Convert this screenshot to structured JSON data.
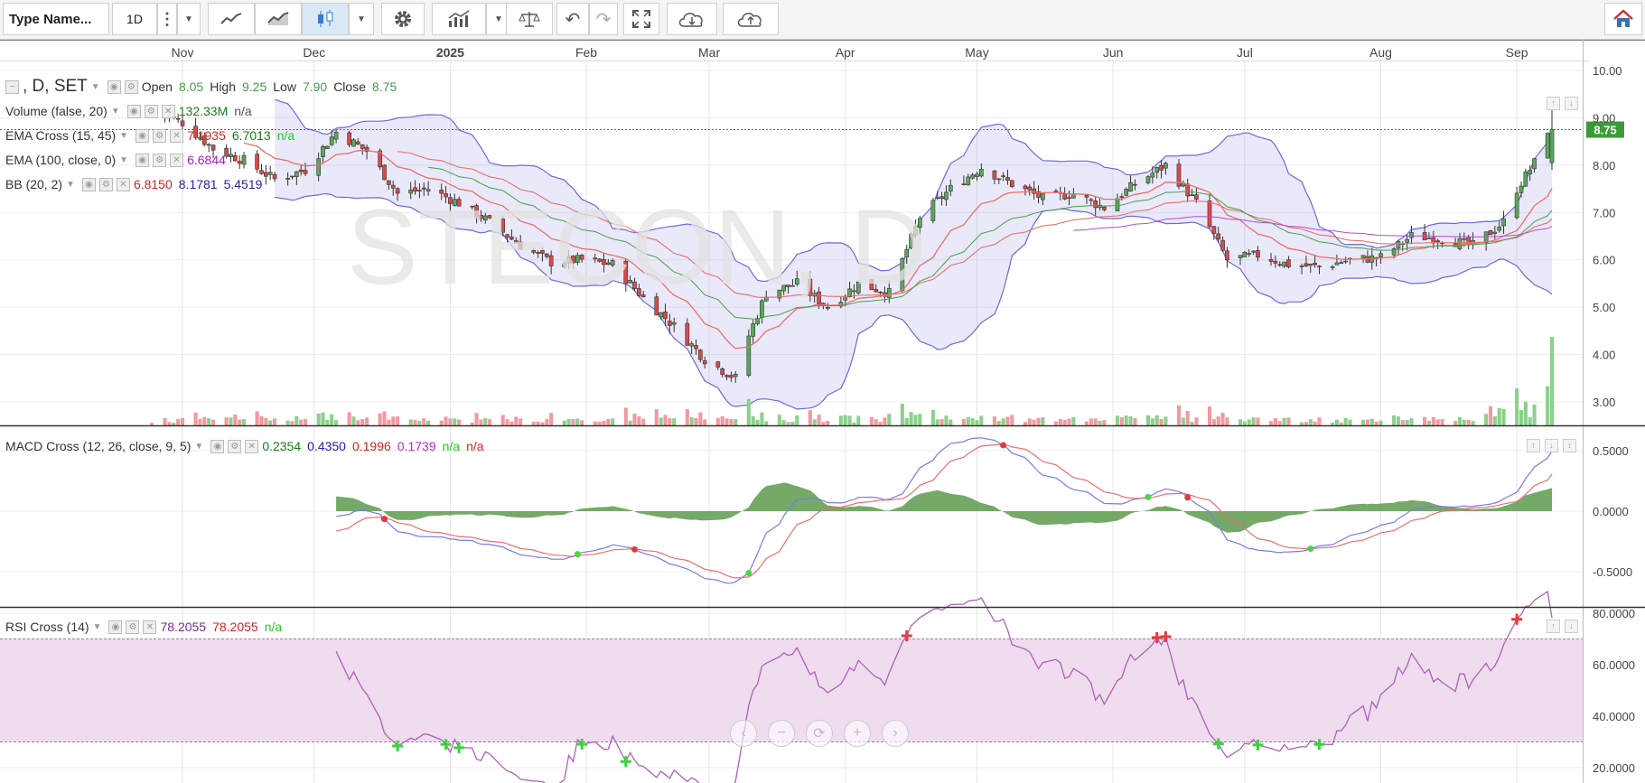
{
  "toolbar": {
    "symbol_placeholder": "Type Name...",
    "interval": "1D",
    "buttons": [
      "more-icon",
      "dropdown-icon",
      "line-chart-icon",
      "area-chart-icon",
      "candlestick-icon",
      "dropdown-icon",
      "settings-icon",
      "indicators-icon",
      "dropdown-icon",
      "compare-icon",
      "undo-icon",
      "redo-icon",
      "fullscreen-icon",
      "cloud-download-icon",
      "cloud-upload-icon",
      "home-icon"
    ]
  },
  "main": {
    "title": ", D, SET",
    "watermark": "STECON, D",
    "ohlc": {
      "open_label": "Open",
      "open": "8.05",
      "high_label": "High",
      "high": "9.25",
      "low_label": "Low",
      "low": "7.90",
      "close_label": "Close",
      "close": "8.75"
    },
    "last_price_tag": "8.75",
    "indicators": [
      {
        "name": "Volume (false, 20)",
        "values": [
          "132.33M",
          "n/a"
        ],
        "colors": [
          "#1a7a1a",
          "#555"
        ]
      },
      {
        "name": "EMA Cross (15, 45)",
        "values": [
          "7.1935",
          "6.7013",
          "n/a"
        ],
        "colors": [
          "#d22",
          "#1a7a1a",
          "#2c2"
        ]
      },
      {
        "name": "EMA (100, close, 0)",
        "values": [
          "6.6844"
        ],
        "colors": [
          "#a020c0"
        ]
      },
      {
        "name": "BB (20, 2)",
        "values": [
          "6.8150",
          "8.1781",
          "5.4519"
        ],
        "colors": [
          "#c22",
          "#22a",
          "#22a"
        ]
      }
    ]
  },
  "macd": {
    "name": "MACD Cross (12, 26, close, 9, 5)",
    "values": [
      "0.2354",
      "0.4350",
      "0.1996",
      "0.1739",
      "n/a",
      "n/a"
    ],
    "colors": [
      "#1a7a1a",
      "#22a",
      "#d22",
      "#c2c",
      "#2c2",
      "#d22"
    ]
  },
  "rsi": {
    "name": "RSI Cross (14)",
    "values": [
      "78.2055",
      "78.2055",
      "n/a"
    ],
    "colors": [
      "#7a2a9a",
      "#d22",
      "#2c2"
    ]
  },
  "chart_data": [
    {
      "type": "candlestick",
      "title": "STECON, D",
      "x_tick_labels": [
        "Nov",
        "Dec",
        "2025",
        "Feb",
        "Mar",
        "Apr",
        "May",
        "Jun",
        "Jul",
        "Aug",
        "Sep"
      ],
      "y_tick_labels": [
        "10.00",
        "9.00",
        "8.00",
        "7.00",
        "6.00",
        "5.00",
        "4.00",
        "3.00"
      ],
      "ylim": [
        2.55,
        10.1
      ],
      "series_close": [
        {
          "date": "2024-10-25",
          "close": 9.2
        },
        {
          "date": "2024-11-01",
          "close": 8.9
        },
        {
          "date": "2024-11-08",
          "close": 8.35
        },
        {
          "date": "2024-11-15",
          "close": 8.1
        },
        {
          "date": "2024-11-22",
          "close": 7.7
        },
        {
          "date": "2024-11-29",
          "close": 7.9
        },
        {
          "date": "2024-12-06",
          "close": 8.7
        },
        {
          "date": "2024-12-13",
          "close": 8.3
        },
        {
          "date": "2024-12-20",
          "close": 7.4
        },
        {
          "date": "2024-12-27",
          "close": 7.5
        },
        {
          "date": "2025-01-03",
          "close": 7.2
        },
        {
          "date": "2025-01-10",
          "close": 6.8
        },
        {
          "date": "2025-01-17",
          "close": 6.3
        },
        {
          "date": "2025-01-24",
          "close": 5.95
        },
        {
          "date": "2025-01-31",
          "close": 6.0
        },
        {
          "date": "2025-02-07",
          "close": 5.9
        },
        {
          "date": "2025-02-14",
          "close": 5.2
        },
        {
          "date": "2025-02-21",
          "close": 4.6
        },
        {
          "date": "2025-02-28",
          "close": 3.9
        },
        {
          "date": "2025-03-07",
          "close": 3.5
        },
        {
          "date": "2025-03-10",
          "close": 4.4
        },
        {
          "date": "2025-03-14",
          "close": 5.3
        },
        {
          "date": "2025-03-21",
          "close": 5.5
        },
        {
          "date": "2025-03-28",
          "close": 5.0
        },
        {
          "date": "2025-04-04",
          "close": 5.5
        },
        {
          "date": "2025-04-11",
          "close": 5.3
        },
        {
          "date": "2025-04-18",
          "close": 6.9
        },
        {
          "date": "2025-04-25",
          "close": 7.5
        },
        {
          "date": "2025-05-02",
          "close": 7.95
        },
        {
          "date": "2025-05-09",
          "close": 7.6
        },
        {
          "date": "2025-05-16",
          "close": 7.3
        },
        {
          "date": "2025-05-23",
          "close": 7.4
        },
        {
          "date": "2025-05-30",
          "close": 7.1
        },
        {
          "date": "2025-06-06",
          "close": 7.6
        },
        {
          "date": "2025-06-13",
          "close": 8.0
        },
        {
          "date": "2025-06-20",
          "close": 7.2
        },
        {
          "date": "2025-06-27",
          "close": 6.0
        },
        {
          "date": "2025-07-04",
          "close": 6.1
        },
        {
          "date": "2025-07-11",
          "close": 5.9
        },
        {
          "date": "2025-07-18",
          "close": 5.85
        },
        {
          "date": "2025-07-25",
          "close": 6.0
        },
        {
          "date": "2025-08-01",
          "close": 6.05
        },
        {
          "date": "2025-08-08",
          "close": 6.5
        },
        {
          "date": "2025-08-15",
          "close": 6.45
        },
        {
          "date": "2025-08-22",
          "close": 6.3
        },
        {
          "date": "2025-08-29",
          "close": 6.8
        },
        {
          "date": "2025-09-01",
          "close": 7.5
        },
        {
          "date": "2025-09-05",
          "close": 8.05
        },
        {
          "date": "2025-09-08",
          "close": 8.75
        }
      ]
    },
    {
      "type": "area",
      "title": "MACD Cross (12, 26, close, 9, 5)",
      "y_tick_labels": [
        "0.5000",
        "0.0000",
        "-0.5000"
      ],
      "ylim": [
        -0.8,
        0.63
      ]
    },
    {
      "type": "line",
      "title": "RSI Cross (14)",
      "y_tick_labels": [
        "80.0000",
        "60.0000",
        "40.0000",
        "20.0000"
      ],
      "ylim": [
        14,
        80
      ],
      "band": [
        30,
        70
      ]
    }
  ]
}
